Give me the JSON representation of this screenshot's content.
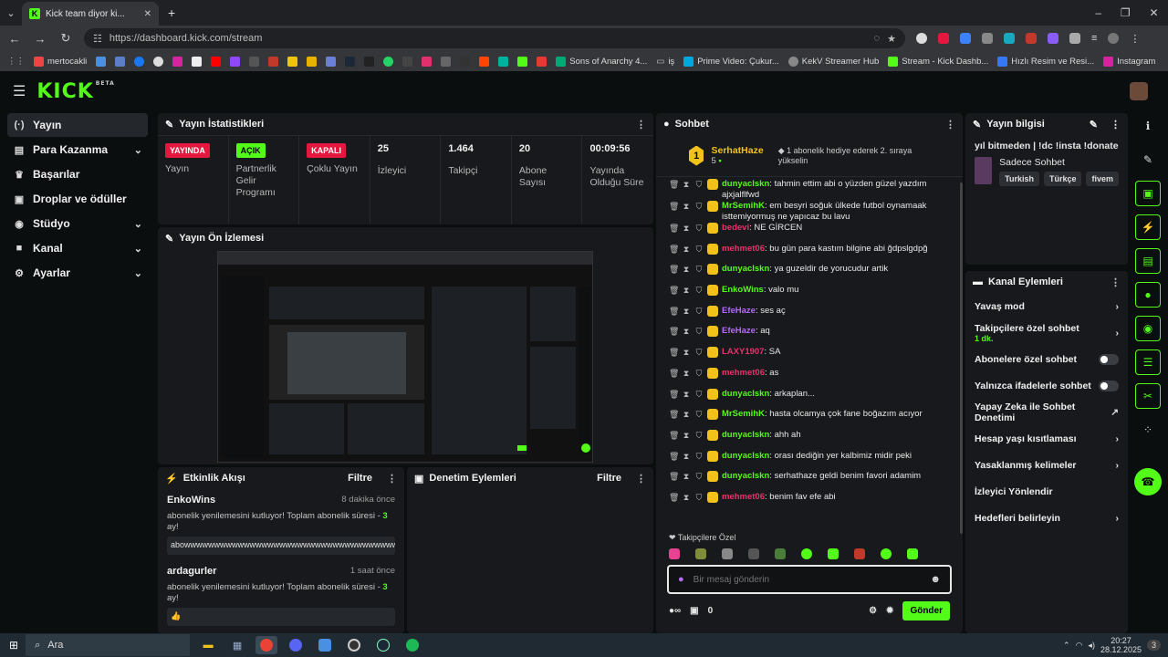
{
  "browser": {
    "tab_title": "Kick team diyor ki...",
    "url": "https://dashboard.kick.com/stream",
    "bookmarks": [
      "mertocakli",
      "Sons of Anarchy 4...",
      "iş",
      "Prime Video: Çukur...",
      "KekV Streamer Hub",
      "Stream - Kick Dashb...",
      "Hızlı Resim ve Resi...",
      "Instagram"
    ]
  },
  "header": {
    "logo": "KICK",
    "beta": "BETA"
  },
  "sidebar": {
    "items": [
      {
        "label": "Yayın",
        "icon": "(·)"
      },
      {
        "label": "Para Kazanma",
        "icon": "▤"
      },
      {
        "label": "Başarılar",
        "icon": "🏆"
      },
      {
        "label": "Droplar ve ödüller",
        "icon": "▣"
      },
      {
        "label": "Stüdyo",
        "icon": "◉"
      },
      {
        "label": "Kanal",
        "icon": "■"
      },
      {
        "label": "Ayarlar",
        "icon": "⚙"
      }
    ]
  },
  "stats": {
    "title": "Yayın İstatistikleri",
    "items": [
      {
        "badge": "YAYINDA",
        "label": "Yayın"
      },
      {
        "badge": "AÇIK",
        "label": "Partnerlik Gelir Programı"
      },
      {
        "badge": "KAPALI",
        "label": "Çoklu Yayın"
      },
      {
        "value": "25",
        "label": "İzleyici"
      },
      {
        "value": "1.464",
        "label": "Takipçi"
      },
      {
        "value": "20",
        "label": "Abone Sayısı"
      },
      {
        "value": "00:09:56",
        "label": "Yayında Olduğu Süre"
      }
    ]
  },
  "preview": {
    "title": "Yayın Ön İzlemesi"
  },
  "activity": {
    "title": "Etkinlik Akışı",
    "filter": "Filtre",
    "events": [
      {
        "user": "EnkoWins",
        "time": "8 dakika önce",
        "msg_pre": "abonelik yenilemesini kutluyor! Toplam abonelik süresi - ",
        "months": "3",
        "msg_post": " ay!",
        "note": "abowwwwwwwwwwwwwwwwwwwwwwwwwwwwwwwwwwwwwwwwwwwwwwwwwwwwwwwww"
      },
      {
        "user": "ardagurler",
        "time": "1 saat önce",
        "msg_pre": "abonelik yenilemesini kutluyor! Toplam abonelik süresi - ",
        "months": "3",
        "msg_post": " ay!",
        "note": "👍"
      }
    ]
  },
  "moderation": {
    "title": "Denetim Eylemleri",
    "filter": "Filtre"
  },
  "chat": {
    "title": "Sohbet",
    "pinned": {
      "user": "SerhatHaze",
      "count": "5",
      "subs": "1",
      "text": "1 abonelik hediye ederek 2. sıraya yükselin"
    },
    "messages": [
      {
        "user": "dunyaclskn",
        "color": "#53fc18",
        "text": "tahmin ettim abi o yüzden güzel yazdım ajxjalflfwd"
      },
      {
        "user": "MrSemihK",
        "color": "#53fc18",
        "text": "em besyri soğuk ülkede futbol oynamaak isttemiyormuş ne yapıcaz bu lavu"
      },
      {
        "user": "bedevi",
        "color": "#e8326b",
        "text": "NE GİRCEN"
      },
      {
        "user": "mehmet06",
        "color": "#e8326b",
        "text": "bu gün para kastım bilgine abi ğdpslgdpğ"
      },
      {
        "user": "dunyaclskn",
        "color": "#53fc18",
        "text": "ya guzeldir de yorucudur artik"
      },
      {
        "user": "EnkoWins",
        "color": "#53fc18",
        "text": "valo mu"
      },
      {
        "user": "EfeHaze",
        "color": "#b46cf7",
        "text": "ses aç"
      },
      {
        "user": "EfeHaze",
        "color": "#b46cf7",
        "text": "aq"
      },
      {
        "user": "LAXY1907",
        "color": "#e8326b",
        "text": "SA"
      },
      {
        "user": "mehmet06",
        "color": "#e8326b",
        "text": "as"
      },
      {
        "user": "dunyaclskn",
        "color": "#53fc18",
        "text": "arkaplan..."
      },
      {
        "user": "MrSemihK",
        "color": "#53fc18",
        "text": "hasta olcamya çok fane boğazım acıyor"
      },
      {
        "user": "dunyaclskn",
        "color": "#53fc18",
        "text": "ahh ah"
      },
      {
        "user": "dunyaclskn",
        "color": "#53fc18",
        "text": "orası dediğin yer kalbimiz midir peki"
      },
      {
        "user": "dunyaclskn",
        "color": "#53fc18",
        "text": "serhathaze geldi benim favori adamim"
      },
      {
        "user": "mehmet06",
        "color": "#e8326b",
        "text": "benim fav efe abi"
      }
    ],
    "followers_only": "Takipçilere Özel",
    "input_placeholder": "Bir mesaj gönderin",
    "count": "0",
    "send": "Gönder"
  },
  "info": {
    "title": "Yayın bilgisi",
    "stream_title": "yıl bitmeden | !dc !insta !donate",
    "category": "Sadece Sohbet",
    "tags": [
      "Turkish",
      "Türkçe",
      "fivem"
    ]
  },
  "channel_actions": {
    "title": "Kanal Eylemleri",
    "items": [
      {
        "label": "Yavaş mod",
        "kind": "chevron"
      },
      {
        "label": "Takipçilere özel sohbet",
        "sub": "1 dk.",
        "kind": "chevron"
      },
      {
        "label": "Abonelere özel sohbet",
        "kind": "toggle"
      },
      {
        "label": "Yalnızca ifadelerle sohbet",
        "kind": "toggle"
      },
      {
        "label": "Yapay Zeka ile Sohbet Denetimi",
        "kind": "external"
      },
      {
        "label": "Hesap yaşı kısıtlaması",
        "kind": "chevron"
      },
      {
        "label": "Yasaklanmış kelimeler",
        "kind": "chevron"
      },
      {
        "label": "İzleyici Yönlendir",
        "kind": "none"
      },
      {
        "label": "Hedefleri belirleyin",
        "kind": "chevron"
      }
    ]
  },
  "taskbar": {
    "search": "Ara",
    "time": "20:27",
    "date": "28.12.2025",
    "notif": "3"
  }
}
